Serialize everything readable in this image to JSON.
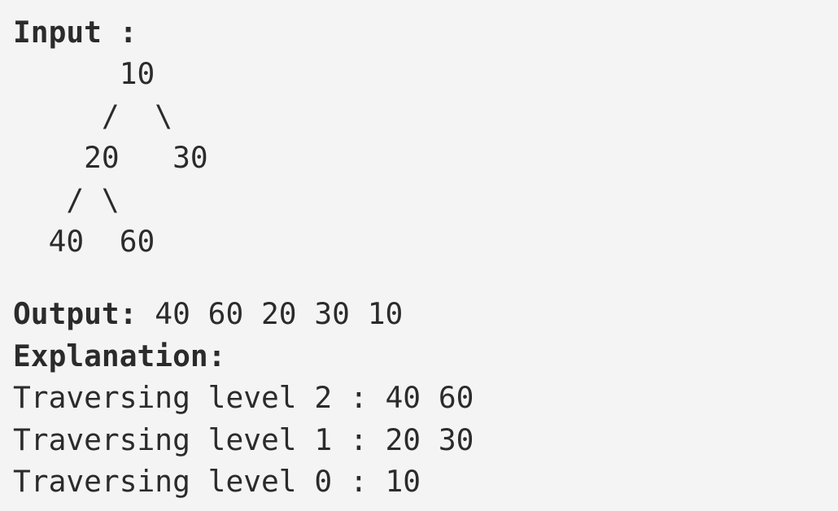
{
  "input": {
    "label": "Input :",
    "tree_lines": [
      "      10",
      "     /  \\",
      "    20   30",
      "   / \\",
      "  40  60"
    ]
  },
  "output": {
    "label": "Output:",
    "value": " 40 60 20 30 10"
  },
  "explanation": {
    "label": "Explanation:",
    "lines": [
      "Traversing level 2 : 40 60",
      "Traversing level 1 : 20 30",
      "Traversing level 0 : 10"
    ]
  }
}
